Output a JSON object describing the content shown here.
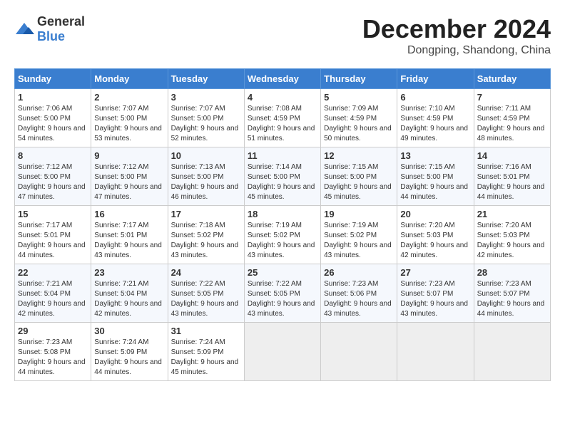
{
  "header": {
    "logo_general": "General",
    "logo_blue": "Blue",
    "month_year": "December 2024",
    "location": "Dongping, Shandong, China"
  },
  "weekdays": [
    "Sunday",
    "Monday",
    "Tuesday",
    "Wednesday",
    "Thursday",
    "Friday",
    "Saturday"
  ],
  "weeks": [
    [
      {
        "day": "1",
        "sunrise": "7:06 AM",
        "sunset": "5:00 PM",
        "daylight": "9 hours and 54 minutes."
      },
      {
        "day": "2",
        "sunrise": "7:07 AM",
        "sunset": "5:00 PM",
        "daylight": "9 hours and 53 minutes."
      },
      {
        "day": "3",
        "sunrise": "7:07 AM",
        "sunset": "5:00 PM",
        "daylight": "9 hours and 52 minutes."
      },
      {
        "day": "4",
        "sunrise": "7:08 AM",
        "sunset": "4:59 PM",
        "daylight": "9 hours and 51 minutes."
      },
      {
        "day": "5",
        "sunrise": "7:09 AM",
        "sunset": "4:59 PM",
        "daylight": "9 hours and 50 minutes."
      },
      {
        "day": "6",
        "sunrise": "7:10 AM",
        "sunset": "4:59 PM",
        "daylight": "9 hours and 49 minutes."
      },
      {
        "day": "7",
        "sunrise": "7:11 AM",
        "sunset": "4:59 PM",
        "daylight": "9 hours and 48 minutes."
      }
    ],
    [
      {
        "day": "8",
        "sunrise": "7:12 AM",
        "sunset": "5:00 PM",
        "daylight": "9 hours and 47 minutes."
      },
      {
        "day": "9",
        "sunrise": "7:12 AM",
        "sunset": "5:00 PM",
        "daylight": "9 hours and 47 minutes."
      },
      {
        "day": "10",
        "sunrise": "7:13 AM",
        "sunset": "5:00 PM",
        "daylight": "9 hours and 46 minutes."
      },
      {
        "day": "11",
        "sunrise": "7:14 AM",
        "sunset": "5:00 PM",
        "daylight": "9 hours and 45 minutes."
      },
      {
        "day": "12",
        "sunrise": "7:15 AM",
        "sunset": "5:00 PM",
        "daylight": "9 hours and 45 minutes."
      },
      {
        "day": "13",
        "sunrise": "7:15 AM",
        "sunset": "5:00 PM",
        "daylight": "9 hours and 44 minutes."
      },
      {
        "day": "14",
        "sunrise": "7:16 AM",
        "sunset": "5:01 PM",
        "daylight": "9 hours and 44 minutes."
      }
    ],
    [
      {
        "day": "15",
        "sunrise": "7:17 AM",
        "sunset": "5:01 PM",
        "daylight": "9 hours and 44 minutes."
      },
      {
        "day": "16",
        "sunrise": "7:17 AM",
        "sunset": "5:01 PM",
        "daylight": "9 hours and 43 minutes."
      },
      {
        "day": "17",
        "sunrise": "7:18 AM",
        "sunset": "5:02 PM",
        "daylight": "9 hours and 43 minutes."
      },
      {
        "day": "18",
        "sunrise": "7:19 AM",
        "sunset": "5:02 PM",
        "daylight": "9 hours and 43 minutes."
      },
      {
        "day": "19",
        "sunrise": "7:19 AM",
        "sunset": "5:02 PM",
        "daylight": "9 hours and 43 minutes."
      },
      {
        "day": "20",
        "sunrise": "7:20 AM",
        "sunset": "5:03 PM",
        "daylight": "9 hours and 42 minutes."
      },
      {
        "day": "21",
        "sunrise": "7:20 AM",
        "sunset": "5:03 PM",
        "daylight": "9 hours and 42 minutes."
      }
    ],
    [
      {
        "day": "22",
        "sunrise": "7:21 AM",
        "sunset": "5:04 PM",
        "daylight": "9 hours and 42 minutes."
      },
      {
        "day": "23",
        "sunrise": "7:21 AM",
        "sunset": "5:04 PM",
        "daylight": "9 hours and 42 minutes."
      },
      {
        "day": "24",
        "sunrise": "7:22 AM",
        "sunset": "5:05 PM",
        "daylight": "9 hours and 43 minutes."
      },
      {
        "day": "25",
        "sunrise": "7:22 AM",
        "sunset": "5:05 PM",
        "daylight": "9 hours and 43 minutes."
      },
      {
        "day": "26",
        "sunrise": "7:23 AM",
        "sunset": "5:06 PM",
        "daylight": "9 hours and 43 minutes."
      },
      {
        "day": "27",
        "sunrise": "7:23 AM",
        "sunset": "5:07 PM",
        "daylight": "9 hours and 43 minutes."
      },
      {
        "day": "28",
        "sunrise": "7:23 AM",
        "sunset": "5:07 PM",
        "daylight": "9 hours and 44 minutes."
      }
    ],
    [
      {
        "day": "29",
        "sunrise": "7:23 AM",
        "sunset": "5:08 PM",
        "daylight": "9 hours and 44 minutes."
      },
      {
        "day": "30",
        "sunrise": "7:24 AM",
        "sunset": "5:09 PM",
        "daylight": "9 hours and 44 minutes."
      },
      {
        "day": "31",
        "sunrise": "7:24 AM",
        "sunset": "5:09 PM",
        "daylight": "9 hours and 45 minutes."
      },
      null,
      null,
      null,
      null
    ]
  ],
  "labels": {
    "sunrise": "Sunrise: ",
    "sunset": "Sunset: ",
    "daylight": "Daylight: "
  }
}
